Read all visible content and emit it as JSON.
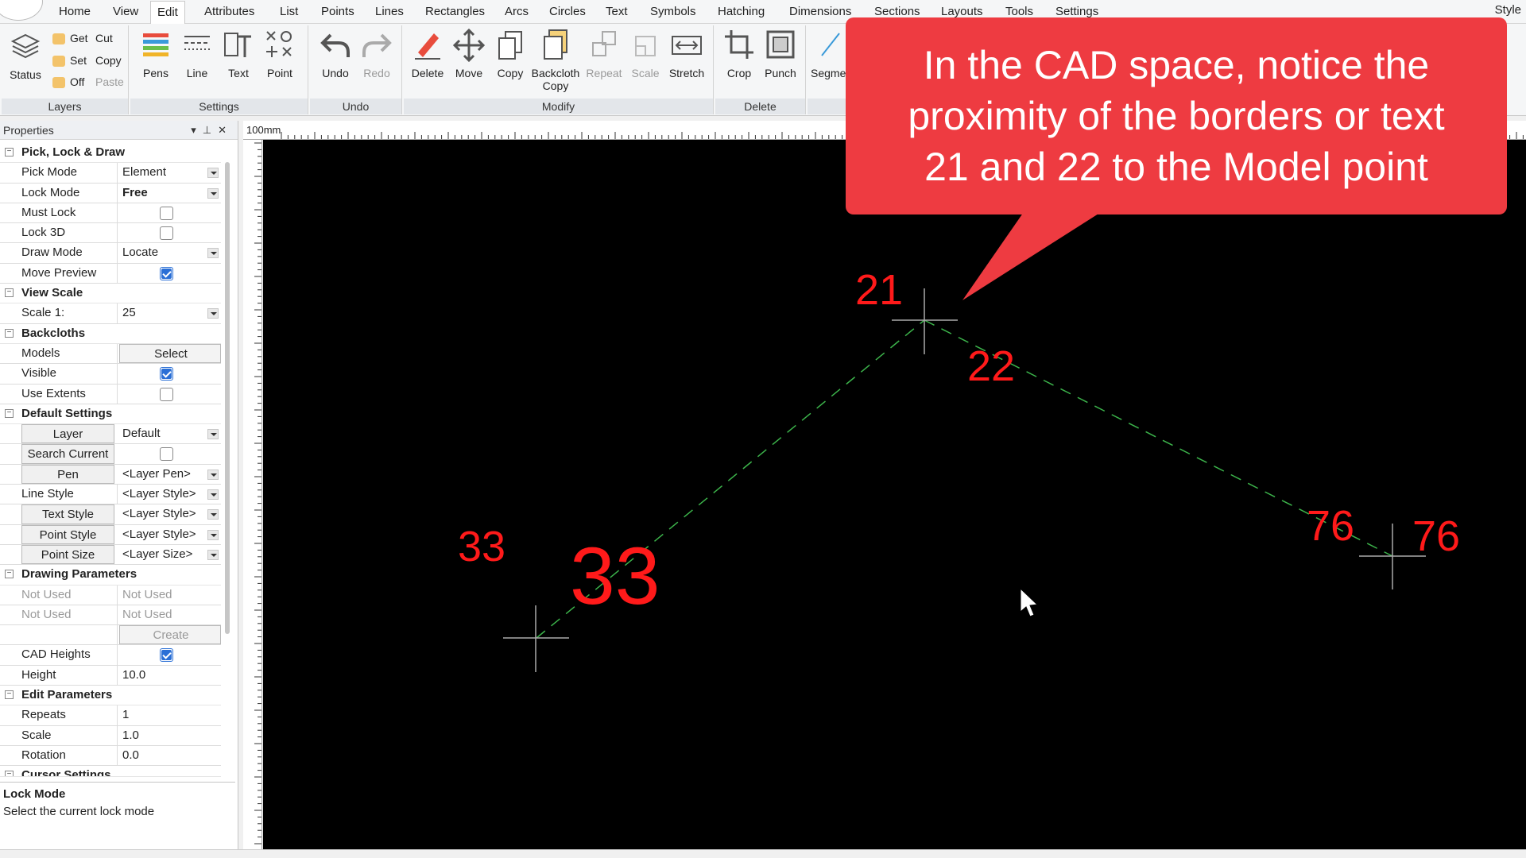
{
  "menu": {
    "items": [
      "Home",
      "View",
      "Edit",
      "Attributes",
      "List",
      "Points",
      "Lines",
      "Rectangles",
      "Arcs",
      "Circles",
      "Text",
      "Symbols",
      "Hatching",
      "Dimensions",
      "Sections",
      "Layouts",
      "Tools",
      "Settings"
    ],
    "active": "Edit",
    "right_label": "Style"
  },
  "ribbon": {
    "layers": {
      "label": "Layers",
      "status": "Status",
      "get": "Get",
      "set": "Set",
      "off": "Off",
      "cut": "Cut",
      "copy": "Copy",
      "paste": "Paste"
    },
    "settings": {
      "label": "Settings",
      "pens": "Pens",
      "line": "Line",
      "text": "Text",
      "point": "Point"
    },
    "undo": {
      "label": "Undo",
      "undo": "Undo",
      "redo": "Redo"
    },
    "modify": {
      "label": "Modify",
      "delete": "Delete",
      "move": "Move",
      "copy": "Copy",
      "backcloth_copy_1": "Backcloth",
      "backcloth_copy_2": "Copy",
      "repeat": "Repeat",
      "scale": "Scale",
      "stretch": "Stretch"
    },
    "delete_group": {
      "label": "Delete",
      "crop": "Crop",
      "punch": "Punch"
    },
    "segment": "Segme"
  },
  "properties": {
    "title": "Properties",
    "categories": {
      "pick": "Pick, Lock & Draw",
      "view_scale": "View Scale",
      "backcloths": "Backcloths",
      "default_settings": "Default Settings",
      "drawing_parameters": "Drawing Parameters",
      "edit_parameters": "Edit Parameters",
      "cursor_settings": "Cursor Settings"
    },
    "rows": {
      "pick_mode": {
        "name": "Pick Mode",
        "value": "Element"
      },
      "lock_mode": {
        "name": "Lock Mode",
        "value": "Free"
      },
      "must_lock": {
        "name": "Must Lock"
      },
      "lock_3d": {
        "name": "Lock 3D"
      },
      "draw_mode": {
        "name": "Draw Mode",
        "value": "Locate"
      },
      "move_preview": {
        "name": "Move Preview"
      },
      "scale": {
        "name": "Scale 1:",
        "value": "25"
      },
      "models": {
        "name": "Models",
        "value": "Select"
      },
      "visible": {
        "name": "Visible"
      },
      "use_extents": {
        "name": "Use Extents"
      },
      "layer": {
        "name": "Layer",
        "value": "Default"
      },
      "search_current": {
        "name": "Search Current"
      },
      "pen": {
        "name": "Pen",
        "value": "<Layer Pen>"
      },
      "line_style": {
        "name": "Line Style",
        "value": "<Layer Style>"
      },
      "text_style": {
        "name": "Text Style",
        "value": "<Layer Style>"
      },
      "point_style": {
        "name": "Point Style",
        "value": "<Layer Style>"
      },
      "point_size": {
        "name": "Point Size",
        "value": "<Layer Size>"
      },
      "not_used_1": {
        "name": "Not Used",
        "value": "Not Used"
      },
      "not_used_2": {
        "name": "Not Used",
        "value": "Not Used"
      },
      "create": {
        "value": "Create"
      },
      "cad_heights": {
        "name": "CAD Heights"
      },
      "height": {
        "name": "Height",
        "value": "10.0"
      },
      "repeats": {
        "name": "Repeats",
        "value": "1"
      },
      "edit_scale": {
        "name": "Scale",
        "value": "1.0"
      },
      "rotation": {
        "name": "Rotation",
        "value": "0.0"
      }
    },
    "checkboxes": {
      "must_lock": false,
      "lock_3d": false,
      "move_preview": true,
      "visible": true,
      "use_extents": false,
      "search_current": false,
      "cad_heights": true
    },
    "description": {
      "title": "Lock Mode",
      "text": "Select the current lock mode"
    }
  },
  "ruler": {
    "label": "100mm"
  },
  "cad": {
    "labels": {
      "p21": "21",
      "p22": "22",
      "p33_small": "33",
      "p33_big": "33",
      "p76_a": "76",
      "p76_b": "76"
    },
    "colors": {
      "text": "#ff1a1a",
      "line": "#3cb44b",
      "cross": "#aaaaaa",
      "background": "#000000"
    }
  },
  "callout": {
    "line1": "In the CAD space, notice the",
    "line2": "proximity of the borders or text",
    "line3": "21 and 22 to the Model point",
    "color": "#ee3b41"
  }
}
